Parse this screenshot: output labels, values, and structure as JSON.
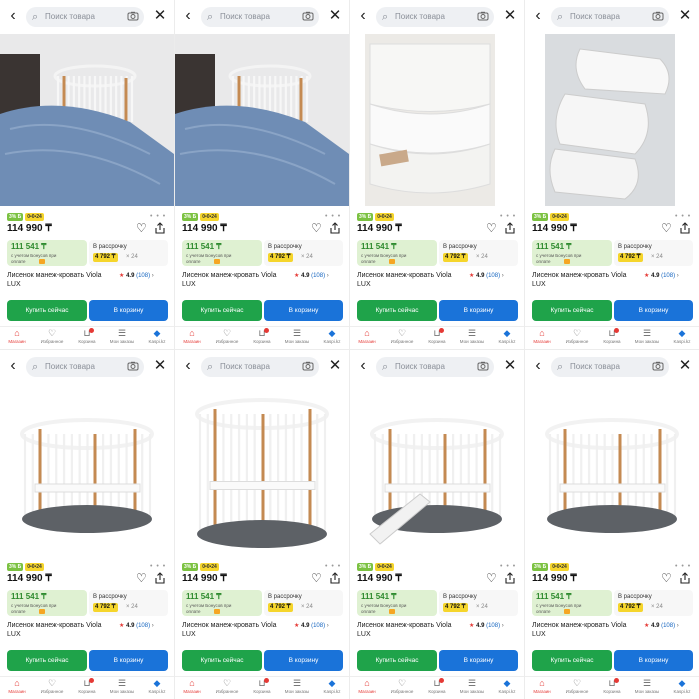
{
  "colors": {
    "buy_button": "#1fa34a",
    "cart_button": "#1a73d9",
    "bonus_green": "#2e8b2e",
    "badge_yellow": "#f5d52b",
    "active_nav": "#e53935"
  },
  "search": {
    "placeholder": "Поиск товара"
  },
  "product": {
    "badge_cashback": "3% Б",
    "badge_installment": "0•0•24",
    "price": "114 990 ₸",
    "bonus_price": "111 541 ₸",
    "bonus_note": "с учетом Бонусов при оплате",
    "installment_label": "В рассрочку",
    "installment_amount": "4 792 ₸",
    "installment_months": "× 24",
    "title": "Лисенок манеж-кровать Viola LUX",
    "rating_star": "★",
    "rating": "4.9",
    "reviews": "(108)",
    "gallery_dots": "• • •"
  },
  "buttons": {
    "buy": "Купить сейчас",
    "cart": "В корзину"
  },
  "nav": [
    {
      "label": "Магазин",
      "icon": "shop-icon"
    },
    {
      "label": "Избранное",
      "icon": "heart-icon"
    },
    {
      "label": "Корзина",
      "icon": "cart-icon"
    },
    {
      "label": "Мои заказы",
      "icon": "orders-icon"
    },
    {
      "label": "Kaspi.kz",
      "icon": "kaspi-icon"
    }
  ],
  "photos": [
    "crib-by-bed",
    "crib-by-bed",
    "mattress-stack",
    "mattress-pieces",
    "round-crib-white",
    "tall-oval-crib",
    "crib-playpen-open",
    "crib-bed-mode"
  ]
}
